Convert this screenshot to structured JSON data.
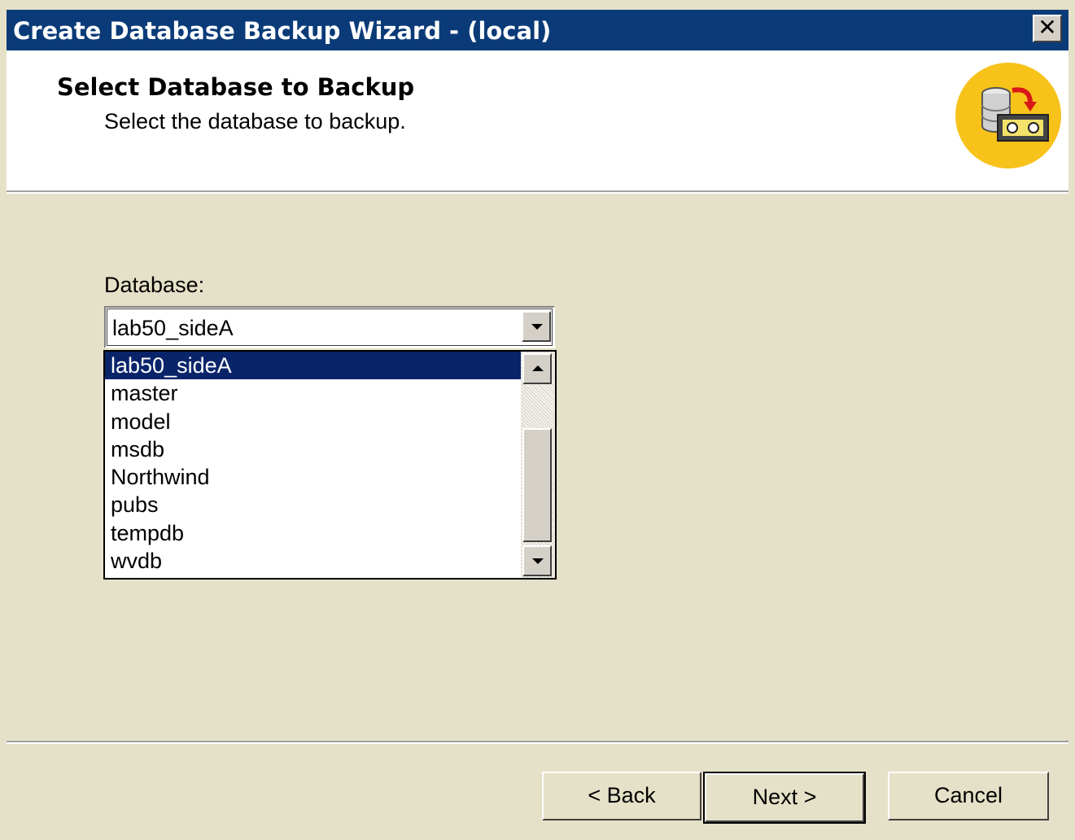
{
  "window": {
    "title": "Create Database Backup Wizard - (local)",
    "close_glyph": "✕",
    "accent_color": "#0a3b78"
  },
  "header": {
    "title": "Select Database to Backup",
    "subtitle": "Select the database to backup.",
    "logo_icon": "database-backup-icon"
  },
  "form": {
    "database_label": "Database:",
    "database_value": "lab50_sideA",
    "options": [
      {
        "label": "lab50_sideA",
        "selected": true
      },
      {
        "label": "master",
        "selected": false
      },
      {
        "label": "model",
        "selected": false
      },
      {
        "label": "msdb",
        "selected": false
      },
      {
        "label": "Northwind",
        "selected": false
      },
      {
        "label": "pubs",
        "selected": false
      },
      {
        "label": "tempdb",
        "selected": false
      },
      {
        "label": "wvdb",
        "selected": false
      }
    ]
  },
  "buttons": {
    "back": "< Back",
    "next": "Next >",
    "cancel": "Cancel"
  }
}
